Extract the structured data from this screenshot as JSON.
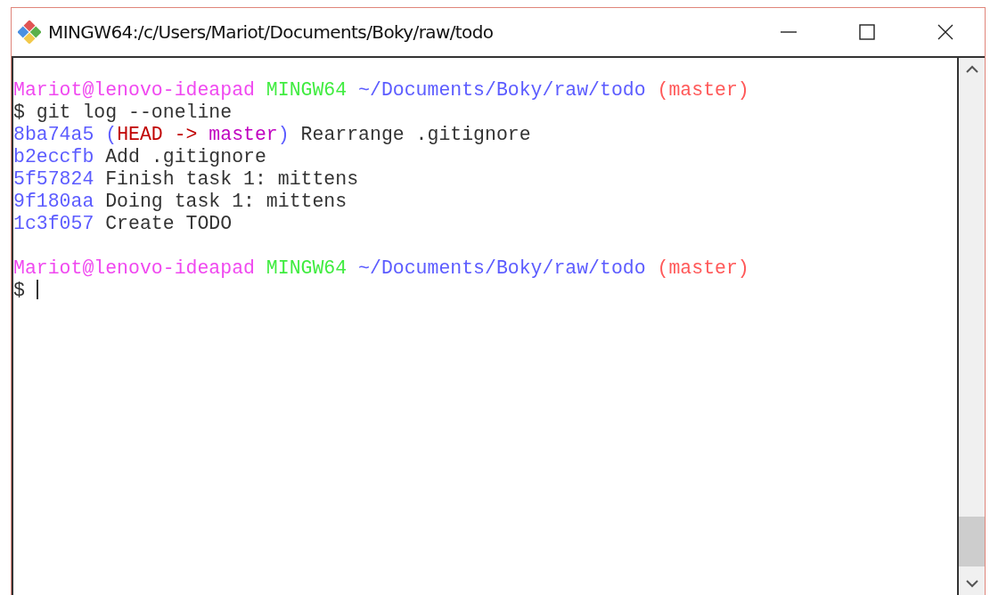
{
  "window": {
    "title": "MINGW64:/c/Users/Mariot/Documents/Boky/raw/todo"
  },
  "terminal": {
    "blocks": [
      {
        "lines": [
          {
            "segments": [
              {
                "text": "Mariot@lenovo-ideapad ",
                "color": "#f048f0"
              },
              {
                "text": "MINGW64 ",
                "color": "#40ec40"
              },
              {
                "text": "~/Documents/Boky/raw/todo ",
                "color": "#5c5cff"
              },
              {
                "text": "(master)",
                "color": "#ff5858"
              }
            ]
          },
          {
            "segments": [
              {
                "text": "$ git log --oneline",
                "color": "#333333"
              }
            ]
          },
          {
            "segments": [
              {
                "text": "8ba74a5 ",
                "color": "#5c5cff"
              },
              {
                "text": "(",
                "color": "#5c5cff"
              },
              {
                "text": "HEAD -> ",
                "color": "#c00000"
              },
              {
                "text": "master",
                "color": "#c000c0"
              },
              {
                "text": ") ",
                "color": "#5c5cff"
              },
              {
                "text": "Rearrange .gitignore",
                "color": "#333333"
              }
            ]
          },
          {
            "segments": [
              {
                "text": "b2eccfb ",
                "color": "#5c5cff"
              },
              {
                "text": "Add .gitignore",
                "color": "#333333"
              }
            ]
          },
          {
            "segments": [
              {
                "text": "5f57824 ",
                "color": "#5c5cff"
              },
              {
                "text": "Finish task 1: mittens",
                "color": "#333333"
              }
            ]
          },
          {
            "segments": [
              {
                "text": "9f180aa ",
                "color": "#5c5cff"
              },
              {
                "text": "Doing task 1: mittens",
                "color": "#333333"
              }
            ]
          },
          {
            "segments": [
              {
                "text": "1c3f057 ",
                "color": "#5c5cff"
              },
              {
                "text": "Create TODO",
                "color": "#333333"
              }
            ]
          }
        ]
      },
      {
        "lines": [
          {
            "segments": [
              {
                "text": "Mariot@lenovo-ideapad ",
                "color": "#f048f0"
              },
              {
                "text": "MINGW64 ",
                "color": "#40ec40"
              },
              {
                "text": "~/Documents/Boky/raw/todo ",
                "color": "#5c5cff"
              },
              {
                "text": "(master)",
                "color": "#ff5858"
              }
            ]
          },
          {
            "segments": [
              {
                "text": "$ ",
                "color": "#333333"
              }
            ],
            "cursor": true
          }
        ]
      }
    ]
  }
}
